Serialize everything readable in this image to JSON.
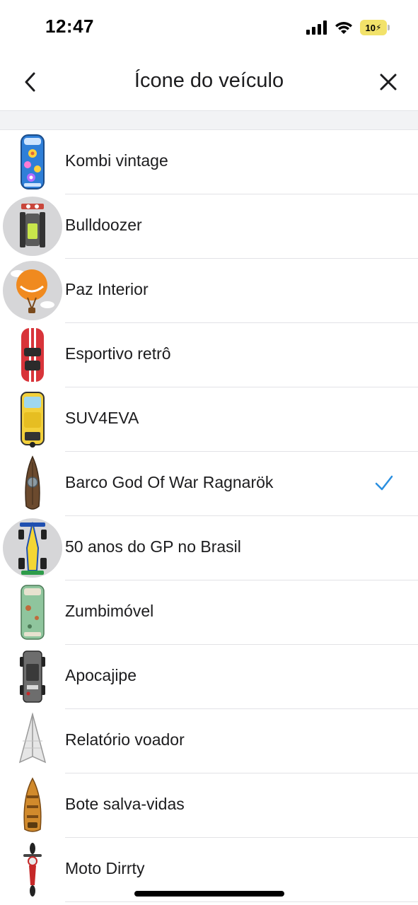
{
  "status": {
    "time": "12:47",
    "battery": "10"
  },
  "header": {
    "title": "Ícone do veículo"
  },
  "vehicles": [
    {
      "label": "Kombi vintage",
      "icon": "kombi-icon",
      "selected": false
    },
    {
      "label": "Bulldoozer",
      "icon": "bulldozer-icon",
      "selected": false
    },
    {
      "label": "Paz Interior",
      "icon": "balloon-icon",
      "selected": false
    },
    {
      "label": "Esportivo retrô",
      "icon": "retro-car-icon",
      "selected": false
    },
    {
      "label": "SUV4EVA",
      "icon": "suv-icon",
      "selected": false
    },
    {
      "label": "Barco God Of War Ragnarök",
      "icon": "viking-boat-icon",
      "selected": true
    },
    {
      "label": "50 anos do GP no Brasil",
      "icon": "formula-car-icon",
      "selected": false
    },
    {
      "label": "Zumbimóvel",
      "icon": "zombie-van-icon",
      "selected": false
    },
    {
      "label": "Apocajipe",
      "icon": "jeep-icon",
      "selected": false
    },
    {
      "label": "Relatório voador",
      "icon": "paper-plane-icon",
      "selected": false
    },
    {
      "label": "Bote salva-vidas",
      "icon": "lifeboat-icon",
      "selected": false
    },
    {
      "label": "Moto Dirrty",
      "icon": "motorcycle-icon",
      "selected": false
    }
  ],
  "colors": {
    "check": "#2a8fe0",
    "divider": "#e2e2e6",
    "section": "#f2f3f5"
  }
}
